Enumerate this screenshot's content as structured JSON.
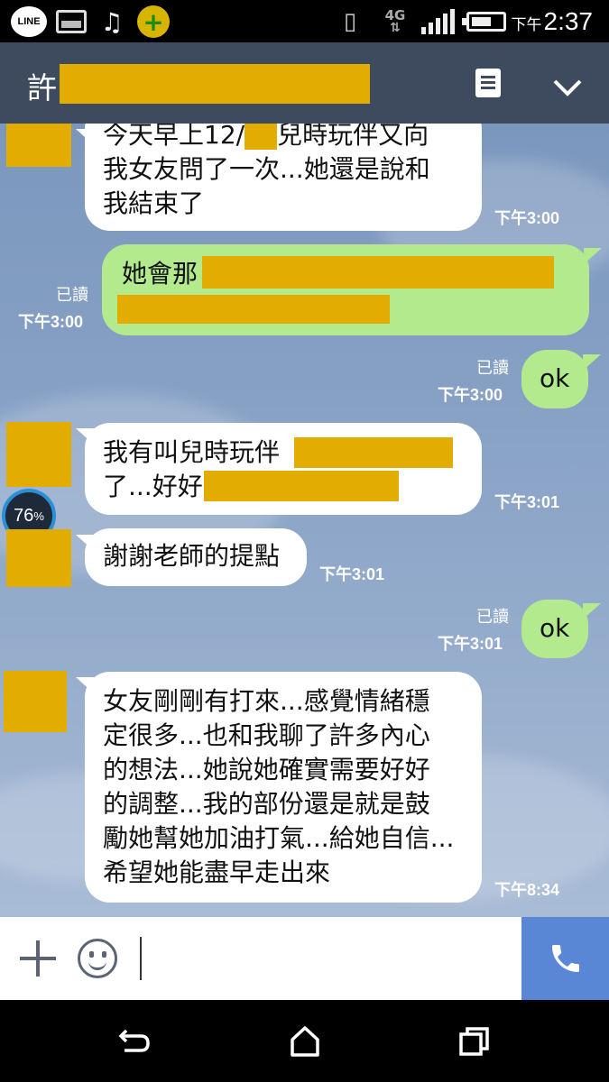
{
  "status_bar": {
    "line_label": "LINE",
    "network": "4G",
    "time_ampm": "下午",
    "time": "2:37",
    "icons": [
      "line-icon",
      "gallery-icon",
      "music-icon",
      "plus-app-icon",
      "vibrate-icon",
      "network-4g-icon",
      "signal-icon",
      "battery-icon"
    ]
  },
  "header": {
    "title": "許",
    "icons": [
      "note-icon",
      "chevron-down-icon"
    ]
  },
  "overlay": {
    "value": "76",
    "unit": "%"
  },
  "messages": [
    {
      "side": "in",
      "lines": [
        "今天早上12/",
        "兒時玩伴又向",
        "我女友問了一次...她還是說和",
        "我結束了"
      ],
      "time": "下午3:00"
    },
    {
      "side": "out",
      "lines": [
        "她會那"
      ],
      "read": "已讀",
      "time": "下午3:00"
    },
    {
      "side": "out",
      "lines": [
        "ok"
      ],
      "read": "已讀",
      "time": "下午3:00"
    },
    {
      "side": "in",
      "lines": [
        "我有叫兒時玩伴",
        "了...好好"
      ],
      "time": "下午3:01"
    },
    {
      "side": "in",
      "lines": [
        "謝謝老師的提點"
      ],
      "time": "下午3:01"
    },
    {
      "side": "out",
      "lines": [
        "ok"
      ],
      "read": "已讀",
      "time": "下午3:01"
    },
    {
      "side": "in",
      "lines": [
        "女友剛剛有打來...感覺情緒穩",
        "定很多...也和我聊了許多內心",
        "的想法...她說她確實需要好好",
        "的調整...我的部份還是就是鼓",
        "勵她幫她加油打氣...給她自信...",
        "希望她能盡早走出來"
      ],
      "time": "下午8:34"
    }
  ],
  "input_bar": {
    "placeholder": "",
    "icons": [
      "plus-icon",
      "emoji-icon",
      "phone-icon"
    ]
  },
  "nav_bar": {
    "icons": [
      "back-icon",
      "home-icon",
      "recents-icon"
    ]
  }
}
